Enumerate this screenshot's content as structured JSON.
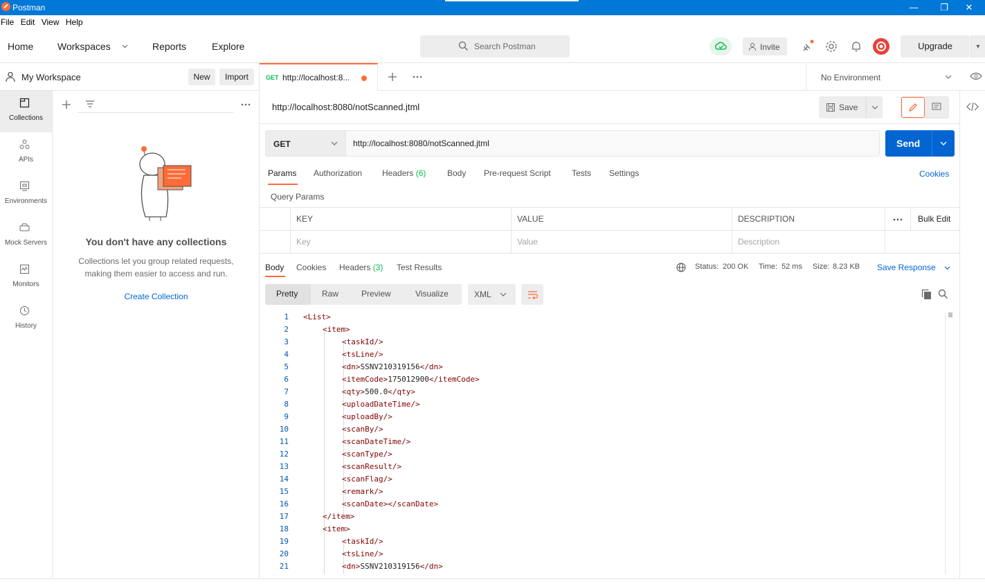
{
  "window": {
    "title": "Postman",
    "minimize": "—",
    "maximize": "❐",
    "close": "✕"
  },
  "menu": [
    "File",
    "Edit",
    "View",
    "Help"
  ],
  "topnav": {
    "home": "Home",
    "workspaces": "Workspaces",
    "reports": "Reports",
    "explore": "Explore",
    "search_placeholder": "Search Postman",
    "invite": "Invite",
    "upgrade": "Upgrade"
  },
  "workspace": {
    "name": "My Workspace",
    "new_label": "New",
    "import_label": "Import"
  },
  "leftnav": [
    {
      "label": "Collections",
      "icon": "collections-icon",
      "active": true
    },
    {
      "label": "APIs",
      "icon": "apis-icon",
      "active": false
    },
    {
      "label": "Environments",
      "icon": "environments-icon",
      "active": false
    },
    {
      "label": "Mock Servers",
      "icon": "mock-servers-icon",
      "active": false
    },
    {
      "label": "Monitors",
      "icon": "monitors-icon",
      "active": false
    },
    {
      "label": "History",
      "icon": "history-icon",
      "active": false
    }
  ],
  "collections_empty": {
    "title": "You don't have any collections",
    "description": "Collections let you group related requests, making them easier to access and run.",
    "create_link": "Create Collection"
  },
  "tab": {
    "method": "GET",
    "url": "http://localhost:8..."
  },
  "environment": {
    "selected": "No Environment"
  },
  "request": {
    "name": "http://localhost:8080/notScanned.jtml",
    "save_label": "Save",
    "method": "GET",
    "url": "http://localhost:8080/notScanned.jtml",
    "send_label": "Send",
    "tabs": {
      "params": "Params",
      "authorization": "Authorization",
      "headers": "Headers",
      "headers_count": "(6)",
      "body": "Body",
      "prerequest": "Pre-request Script",
      "tests": "Tests",
      "settings": "Settings"
    },
    "cookies_label": "Cookies",
    "query_params_title": "Query Params",
    "params_table": {
      "key_header": "KEY",
      "value_header": "VALUE",
      "description_header": "DESCRIPTION",
      "bulk_edit": "Bulk Edit",
      "key_placeholder": "Key",
      "value_placeholder": "Value",
      "description_placeholder": "Description"
    }
  },
  "response": {
    "tabs": {
      "body": "Body",
      "cookies": "Cookies",
      "headers": "Headers",
      "headers_count": "(3)",
      "test_results": "Test Results"
    },
    "status_label": "Status:",
    "status_value": "200 OK",
    "time_label": "Time:",
    "time_value": "52 ms",
    "size_label": "Size:",
    "size_value": "8.23 KB",
    "save_response": "Save Response",
    "format_tabs": {
      "pretty": "Pretty",
      "raw": "Raw",
      "preview": "Preview",
      "visualize": "Visualize"
    },
    "language": "XML",
    "code_lines": [
      {
        "n": "1",
        "indent": 0,
        "text": "<List>"
      },
      {
        "n": "2",
        "indent": 1,
        "text": "<item>"
      },
      {
        "n": "3",
        "indent": 2,
        "text": "<taskId/>"
      },
      {
        "n": "4",
        "indent": 2,
        "text": "<tsLine/>"
      },
      {
        "n": "5",
        "indent": 2,
        "text": "<dn>SSNV210319156</dn>"
      },
      {
        "n": "6",
        "indent": 2,
        "text": "<itemCode>175012900</itemCode>"
      },
      {
        "n": "7",
        "indent": 2,
        "text": "<qty>500.0</qty>"
      },
      {
        "n": "8",
        "indent": 2,
        "text": "<uploadDateTime/>"
      },
      {
        "n": "9",
        "indent": 2,
        "text": "<uploadBy/>"
      },
      {
        "n": "10",
        "indent": 2,
        "text": "<scanBy/>"
      },
      {
        "n": "11",
        "indent": 2,
        "text": "<scanDateTime/>"
      },
      {
        "n": "12",
        "indent": 2,
        "text": "<scanType/>"
      },
      {
        "n": "13",
        "indent": 2,
        "text": "<scanResult/>"
      },
      {
        "n": "14",
        "indent": 2,
        "text": "<scanFlag/>"
      },
      {
        "n": "15",
        "indent": 2,
        "text": "<remark/>"
      },
      {
        "n": "16",
        "indent": 2,
        "text": "<scanDate></scanDate>"
      },
      {
        "n": "17",
        "indent": 1,
        "text": "</item>"
      },
      {
        "n": "18",
        "indent": 1,
        "text": "<item>"
      },
      {
        "n": "19",
        "indent": 2,
        "text": "<taskId/>"
      },
      {
        "n": "20",
        "indent": 2,
        "text": "<tsLine/>"
      },
      {
        "n": "21",
        "indent": 2,
        "text": "<dn>SSNV210319156</dn>"
      }
    ]
  },
  "colors": {
    "accent": "#ff6c37",
    "primary": "#0265d2",
    "success": "#0cbb52",
    "titlebar": "#0078d7",
    "xml_tag": "#800000",
    "line_number": "#0057b3"
  }
}
